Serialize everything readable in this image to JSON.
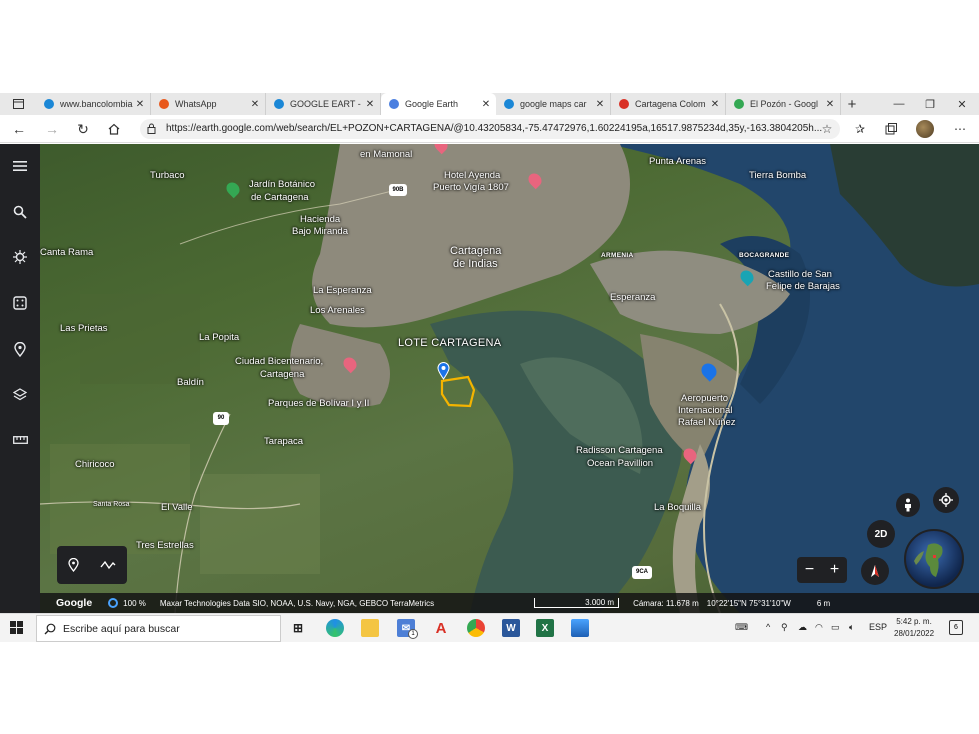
{
  "browser": {
    "tabs": [
      {
        "title": "www.bancolombia",
        "favicon": "bing-icon",
        "color": "#1b87d6"
      },
      {
        "title": "WhatsApp",
        "favicon": "alert-icon",
        "color": "#e8581c"
      },
      {
        "title": "GOOGLE EART - ",
        "favicon": "bing-icon",
        "color": "#1b87d6"
      },
      {
        "title": "Google Earth",
        "favicon": "earth-icon",
        "color": "#4a7fe0",
        "active": true
      },
      {
        "title": "google maps car",
        "favicon": "bing-icon",
        "color": "#1b87d6"
      },
      {
        "title": "Cartagena Colom",
        "favicon": "pin-icon",
        "color": "#d93025"
      },
      {
        "title": "El Pozón - Googl",
        "favicon": "maps-icon",
        "color": "#34a853"
      }
    ],
    "url": "https://earth.google.com/web/search/EL+POZON+CARTAGENA/@10.43205834,-75.47472976,1.60224195a,16517.9875234d,35y,-163.3804205h..."
  },
  "map": {
    "labels": {
      "en_mamonal": "en Mamonal",
      "turbaco": "Turbaco",
      "jardin1": "Jardín Botánico",
      "jardin2": "de Cartagena",
      "hotel1": "Hotel Ayenda",
      "hotel2": "Puerto Vigía 1807",
      "punta_arenas": "Punta Arenas",
      "tierra_bomba": "Tierra Bomba",
      "hacienda1": "Hacienda",
      "hacienda2": "Bajo Miranda",
      "canta_rama": "Canta Rama",
      "cartagena1": "Cartagena",
      "cartagena2": "de Indias",
      "armenia": "ARMENIA",
      "bocagrande": "BOCAGRANDE",
      "castillo1": "Castillo de San",
      "castillo2": "Felipe de Barajas",
      "la_esperanza": "La Esperanza",
      "esperanza": "Esperanza",
      "los_arenales": "Los Arenales",
      "las_prietas": "Las Prietas",
      "la_popita": "La Popita",
      "lote": "LOTE CARTAGENA",
      "ciudad1": "Ciudad Bicentenario,",
      "ciudad2": "Cartagena",
      "baldin": "Baldín",
      "parques": "Parques de Bolívar I y II",
      "aero1": "Aeropuerto",
      "aero2": "Internacional",
      "aero3": "Rafael Núñez",
      "tarapaca": "Tarapaca",
      "radisson1": "Radisson Cartagena",
      "radisson2": "Ocean Pavillion",
      "chiricoco": "Chiricoco",
      "santa_rosa": "Santa Rosa",
      "el_valle": "El Valle",
      "la_boquilla": "La Boquilla",
      "tres_estrellas": "Tres Estrellas",
      "road_90b": "90B",
      "road_90": "90",
      "road_9ca": "9CA"
    },
    "buttons": {
      "mode_2d": "2D"
    },
    "status": {
      "logo": "Google",
      "zoom": "100 %",
      "attribution": "Maxar Technologies  Data SIO, NOAA, U.S. Navy, NGA, GEBCO  TerraMetrics",
      "scale": "3.000 m",
      "camera": "Cámara: 11.678 m",
      "coords": "10°22'15\"N 75°31'10\"W",
      "elevation": "6 m"
    }
  },
  "taskbar": {
    "search_placeholder": "Escribe aquí para buscar",
    "mail_badge": "1",
    "lang": "ESP",
    "time": "5:42 p. m.",
    "date": "28/01/2022",
    "notifications": "6"
  }
}
